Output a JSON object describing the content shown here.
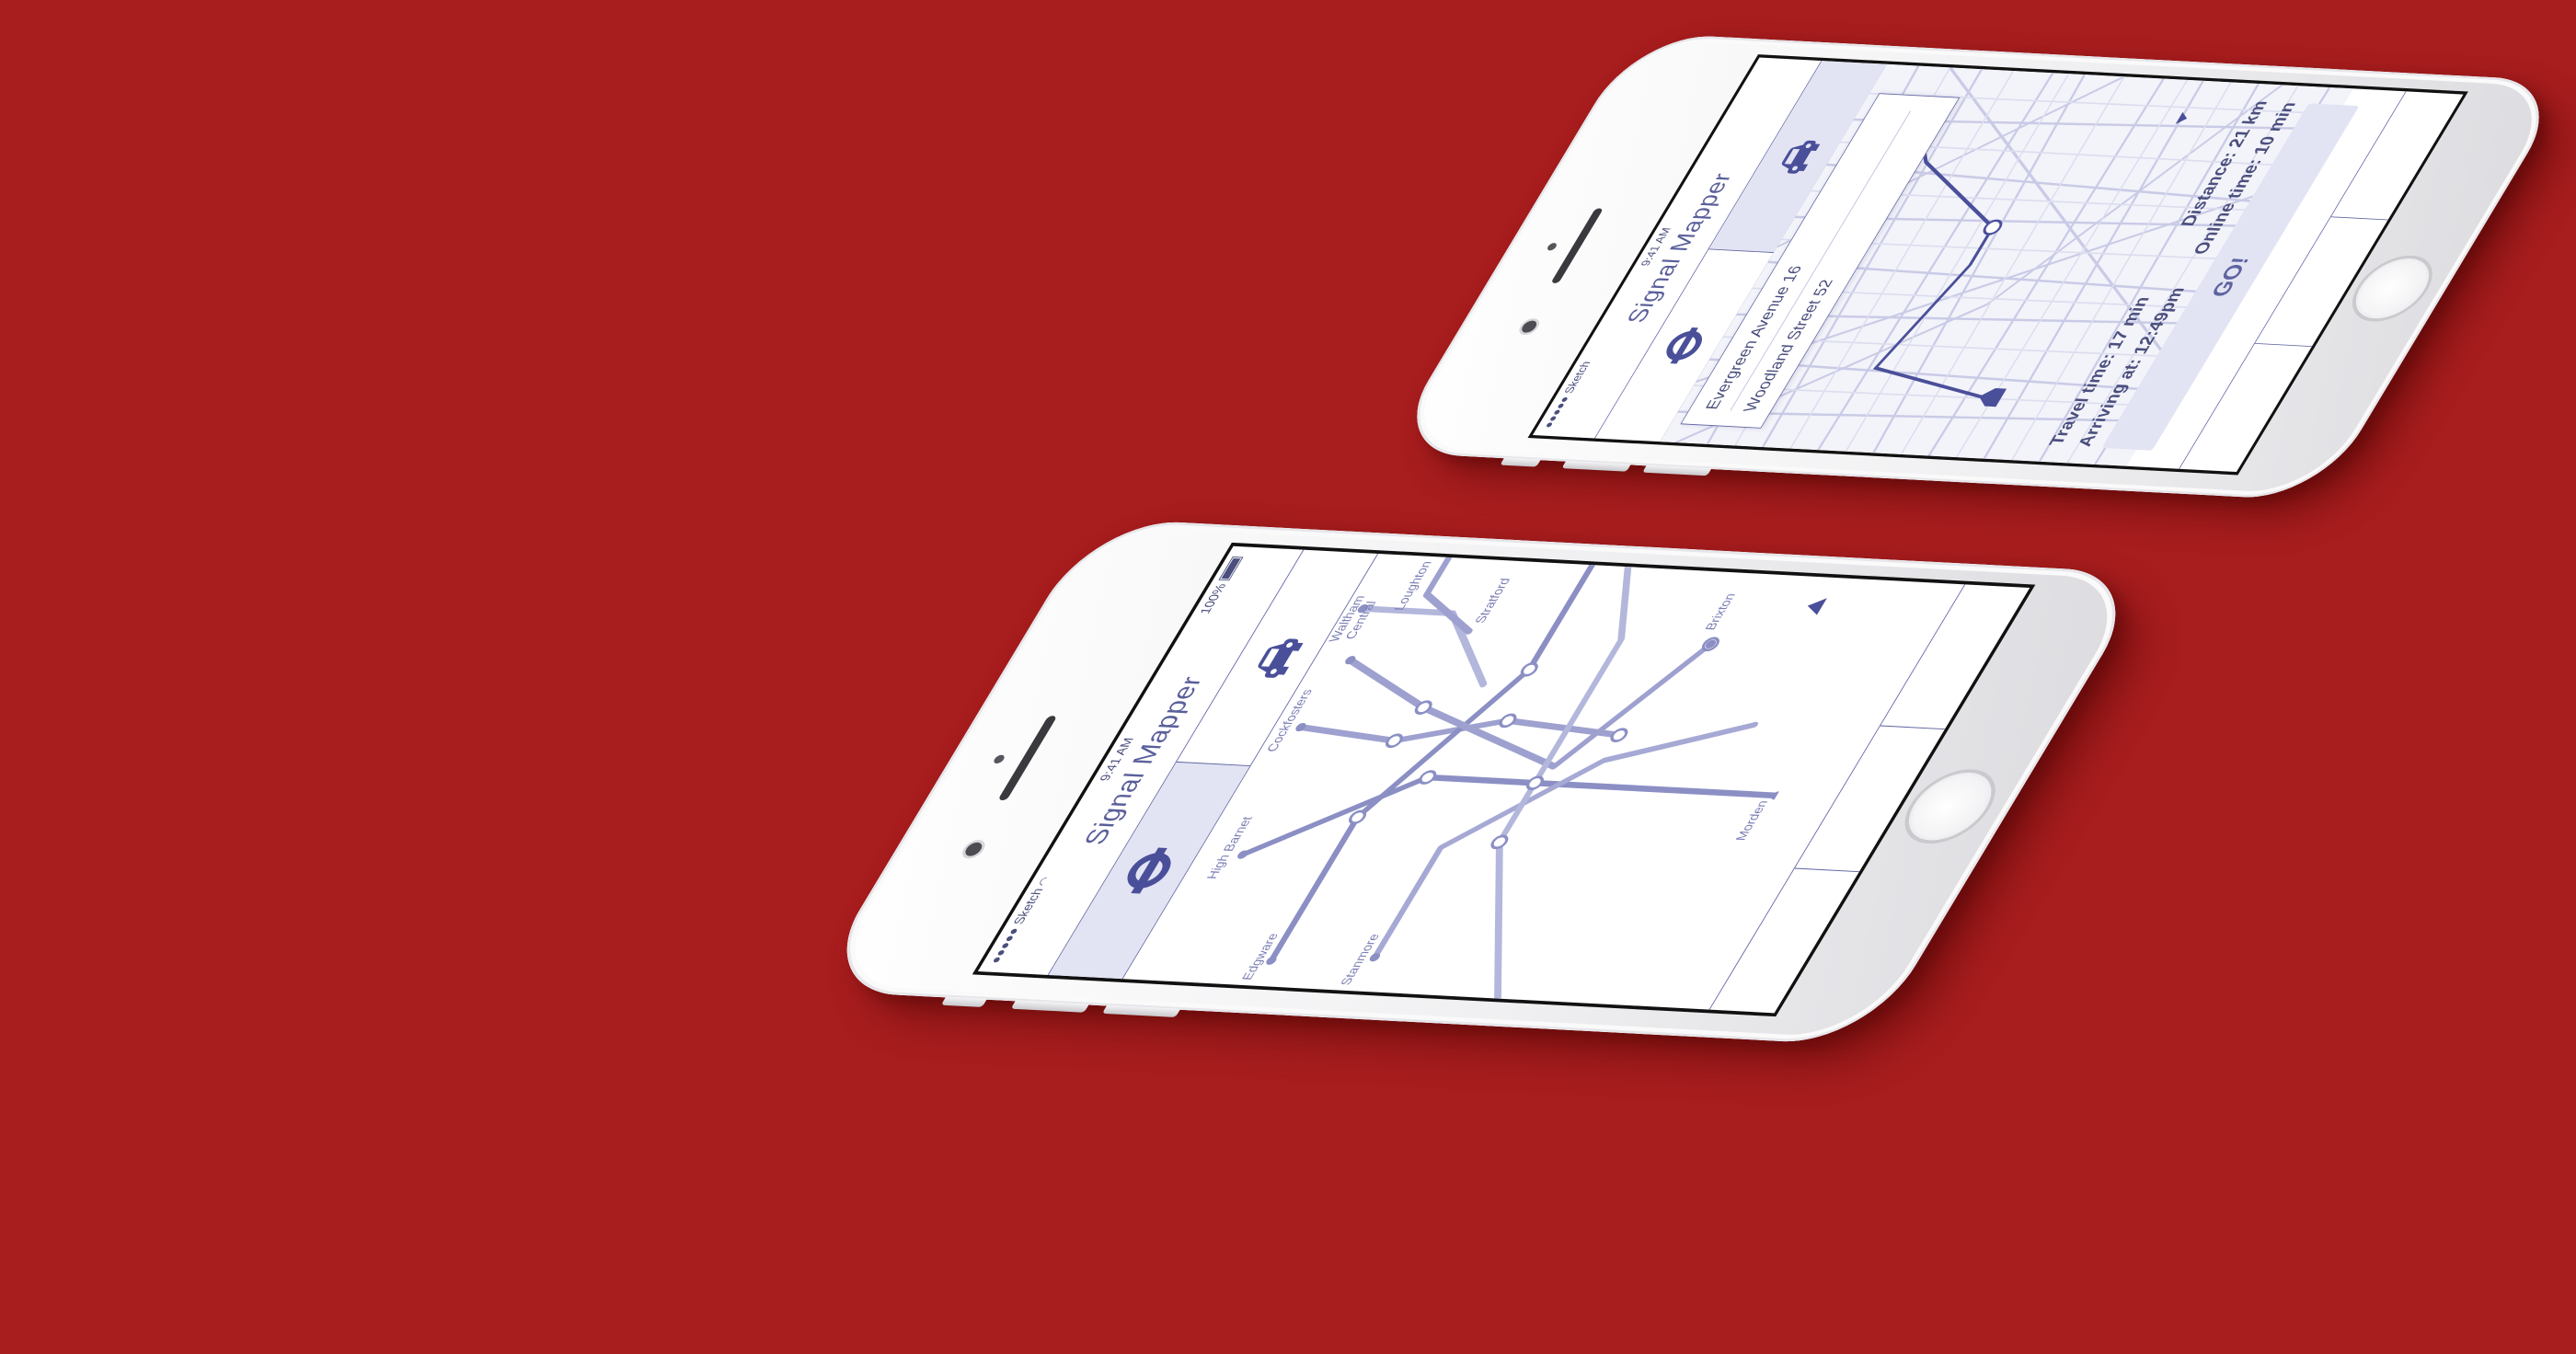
{
  "background_color": "#a81d1e",
  "accent_color": "#5e63a0",
  "phones": {
    "front": {
      "status": {
        "carrier": "●●●●● Sketch",
        "time": "9:41 AM",
        "battery": "100%"
      },
      "app_title": "Signal Mapper",
      "tabs": [
        {
          "icon": "underground-roundel-icon",
          "active": true
        },
        {
          "icon": "car-icon",
          "active": false
        }
      ],
      "stations": {
        "high_barnet": "High Barnet",
        "cockfosters": "Cockfosters",
        "waltham": "Waltham",
        "central": "Central",
        "loughton": "Loughton",
        "stratford": "Stratford",
        "edgware": "Edgware",
        "stanmore": "Stanmore",
        "brixton": "Brixton",
        "morden": "Morden"
      }
    },
    "back": {
      "status": {
        "carrier": "●●●●● Sketch",
        "time": "9:41 AM"
      },
      "app_title": "Signal Mapper",
      "tabs": [
        {
          "icon": "underground-roundel-icon",
          "active": false
        },
        {
          "icon": "car-icon",
          "active": true
        }
      ],
      "route": {
        "from": "Evergreen Avenue 16",
        "to": "Woodland Street 52"
      },
      "trip": {
        "travel_time": "Travel time: 17 min",
        "distance": "Distance: 21 km",
        "arriving": "Arriving at: 12:49pm",
        "online_time": "Online time: 10 min"
      },
      "go_label": "GO!"
    }
  }
}
